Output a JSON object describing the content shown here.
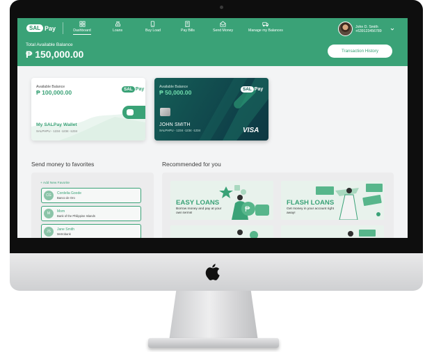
{
  "app": {
    "logo": {
      "sal": "SAL",
      "pay": "Pay"
    },
    "accent_color": "#3aa277",
    "nav": [
      {
        "label": "Dashboard",
        "icon": "dashboard-icon",
        "active": true
      },
      {
        "label": "Loans",
        "icon": "loans-icon",
        "active": false
      },
      {
        "label": "Buy Load",
        "icon": "buy-load-icon",
        "active": false
      },
      {
        "label": "Pay Bills",
        "icon": "pay-bills-icon",
        "active": false
      },
      {
        "label": "Send Money",
        "icon": "send-money-icon",
        "active": false
      },
      {
        "label": "Manage my Balances",
        "icon": "manage-balances-icon",
        "active": false
      }
    ],
    "user": {
      "name": "John D. Smith",
      "phone": "+639123456789"
    }
  },
  "balance": {
    "label": "Total Available Balance",
    "amount": "₱ 150,000.00",
    "transaction_history_label": "Transaction History"
  },
  "cards": [
    {
      "label": "Available Balance",
      "amount": "₱ 100,000.00",
      "name": "My SALPay Wallet",
      "number": "SALPHPU - 1234 -1234 -1234"
    },
    {
      "label": "Available Balance",
      "amount": "₱ 50,000.00",
      "holder": "JOHN SMITH",
      "number": "SALPHPU - 1234 -1234 -1234",
      "network": "VISA"
    }
  ],
  "favorites": {
    "title": "Send money to favorites",
    "add_label": "+ Add New Favorite",
    "items": [
      {
        "initials": "CG",
        "name": "Cordelia Goode",
        "bank": "Banco de Oro"
      },
      {
        "initials": "M",
        "name": "Mom",
        "bank": "Bank of the Philippine Islands"
      },
      {
        "initials": "JS",
        "name": "Jane Smith",
        "bank": "Metrobank"
      }
    ]
  },
  "recommended": {
    "title": "Recommended for you",
    "items": [
      {
        "title": "EASY LOANS",
        "subtitle": "Borrow money and pay at your own terms!"
      },
      {
        "title": "FLASH LOANS",
        "subtitle": "Get money in your account right away!"
      }
    ]
  }
}
